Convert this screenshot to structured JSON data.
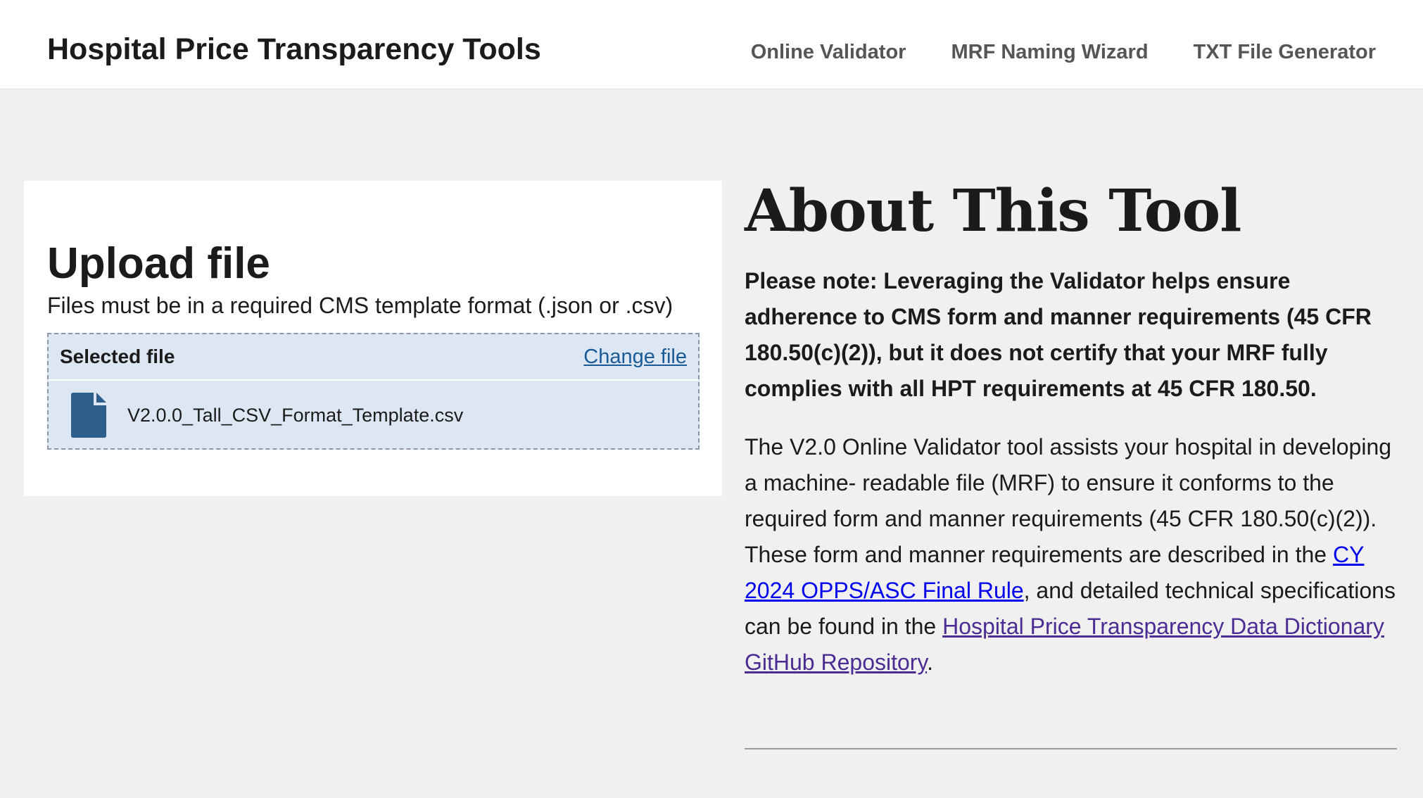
{
  "header": {
    "site_title": "Hospital Price Transparency Tools",
    "nav": [
      {
        "label": "Online Validator"
      },
      {
        "label": "MRF Naming Wizard"
      },
      {
        "label": "TXT File Generator"
      }
    ]
  },
  "upload": {
    "title": "Upload file",
    "hint": "Files must be in a required CMS template format (.json or .csv)",
    "selected_label": "Selected file",
    "change_label": "Change file",
    "file_name": "V2.0.0_Tall_CSV_Format_Template.csv",
    "file_icon": "file-icon",
    "file_icon_color": "#2d5f8a",
    "dropzone_color": "#dce7f3"
  },
  "about": {
    "title": "About This Tool",
    "note": "Please note: Leveraging the Validator helps ensure adherence to CMS form and manner requirements (45 CFR 180.50(c)(2)), but it does not certify that your MRF fully complies with all HPT requirements at 45 CFR 180.50.",
    "body_part1": "The V2.0 Online Validator tool assists your hospital in developing a machine- readable file (MRF) to ensure it conforms to the required form and manner requirements (45 CFR 180.50(c)(2)). These form and manner requirements are described in the ",
    "link1": "CY 2024 OPPS/ASC Final Rule",
    "body_part2": ", and detailed technical specifications can be found in the ",
    "link2": "Hospital Price Transparency Data Dictionary GitHub Repository",
    "body_part3": "."
  },
  "colors": {
    "page_bg": "#f0f0f0",
    "link_blue": "#0000ee",
    "link_visited": "#4c2c92",
    "change_link": "#1a5a96"
  }
}
